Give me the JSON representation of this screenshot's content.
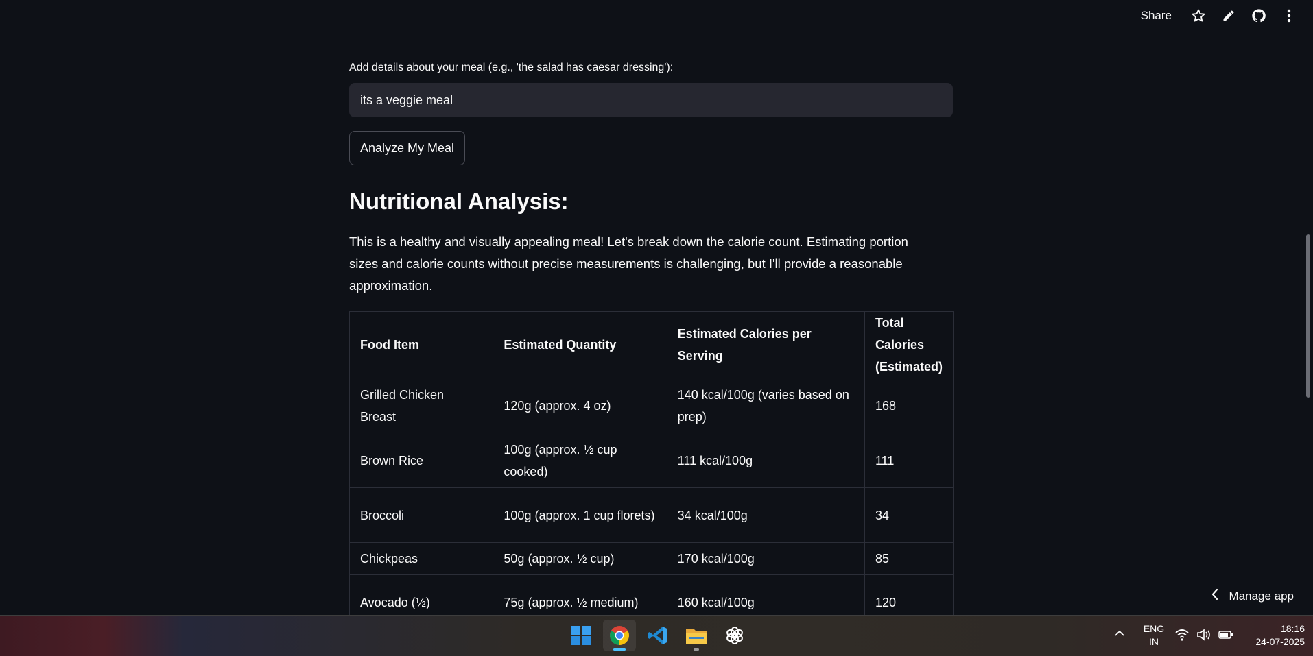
{
  "toolbar": {
    "share_label": "Share",
    "icons": [
      "star-icon",
      "pencil-icon",
      "github-icon",
      "more-vertical-icon"
    ]
  },
  "form": {
    "details_label": "Add details about your meal (e.g., 'the salad has caesar dressing'):",
    "details_value": "its a veggie meal",
    "analyze_button": "Analyze My Meal"
  },
  "analysis": {
    "heading": "Nutritional Analysis:",
    "intro": "This is a healthy and visually appealing meal! Let's break down the calorie count. Estimating portion sizes and calorie counts without precise measurements is challenging, but I'll provide a reasonable approximation.",
    "table": {
      "headers": [
        "Food Item",
        "Estimated Quantity",
        "Estimated Calories per Serving",
        "Total Calories (Estimated)"
      ],
      "rows": [
        [
          "Grilled Chicken Breast",
          "120g (approx. 4 oz)",
          "140 kcal/100g (varies based on prep)",
          "168"
        ],
        [
          "Brown Rice",
          "100g (approx. ½ cup cooked)",
          "111 kcal/100g",
          "111"
        ],
        [
          "Broccoli",
          "100g (approx. 1 cup florets)",
          "34 kcal/100g",
          "34"
        ],
        [
          "Chickpeas",
          "50g (approx. ½ cup)",
          "170 kcal/100g",
          "85"
        ],
        [
          "Avocado (½)",
          "75g (approx. ½ medium)",
          "160 kcal/100g",
          "120"
        ]
      ]
    }
  },
  "manage_app": {
    "label": "Manage app"
  },
  "taskbar": {
    "apps": [
      "windows-start-icon",
      "chrome-icon",
      "vscode-icon",
      "file-explorer-icon",
      "chatgpt-icon"
    ],
    "active_app": "chrome-icon",
    "lang_line1": "ENG",
    "lang_line2": "IN",
    "time": "18:16",
    "date": "24-07-2025"
  },
  "colors": {
    "background": "#0e1117",
    "input_bg": "#262730",
    "text": "#fafafa",
    "table_border": "#2b2e38"
  }
}
